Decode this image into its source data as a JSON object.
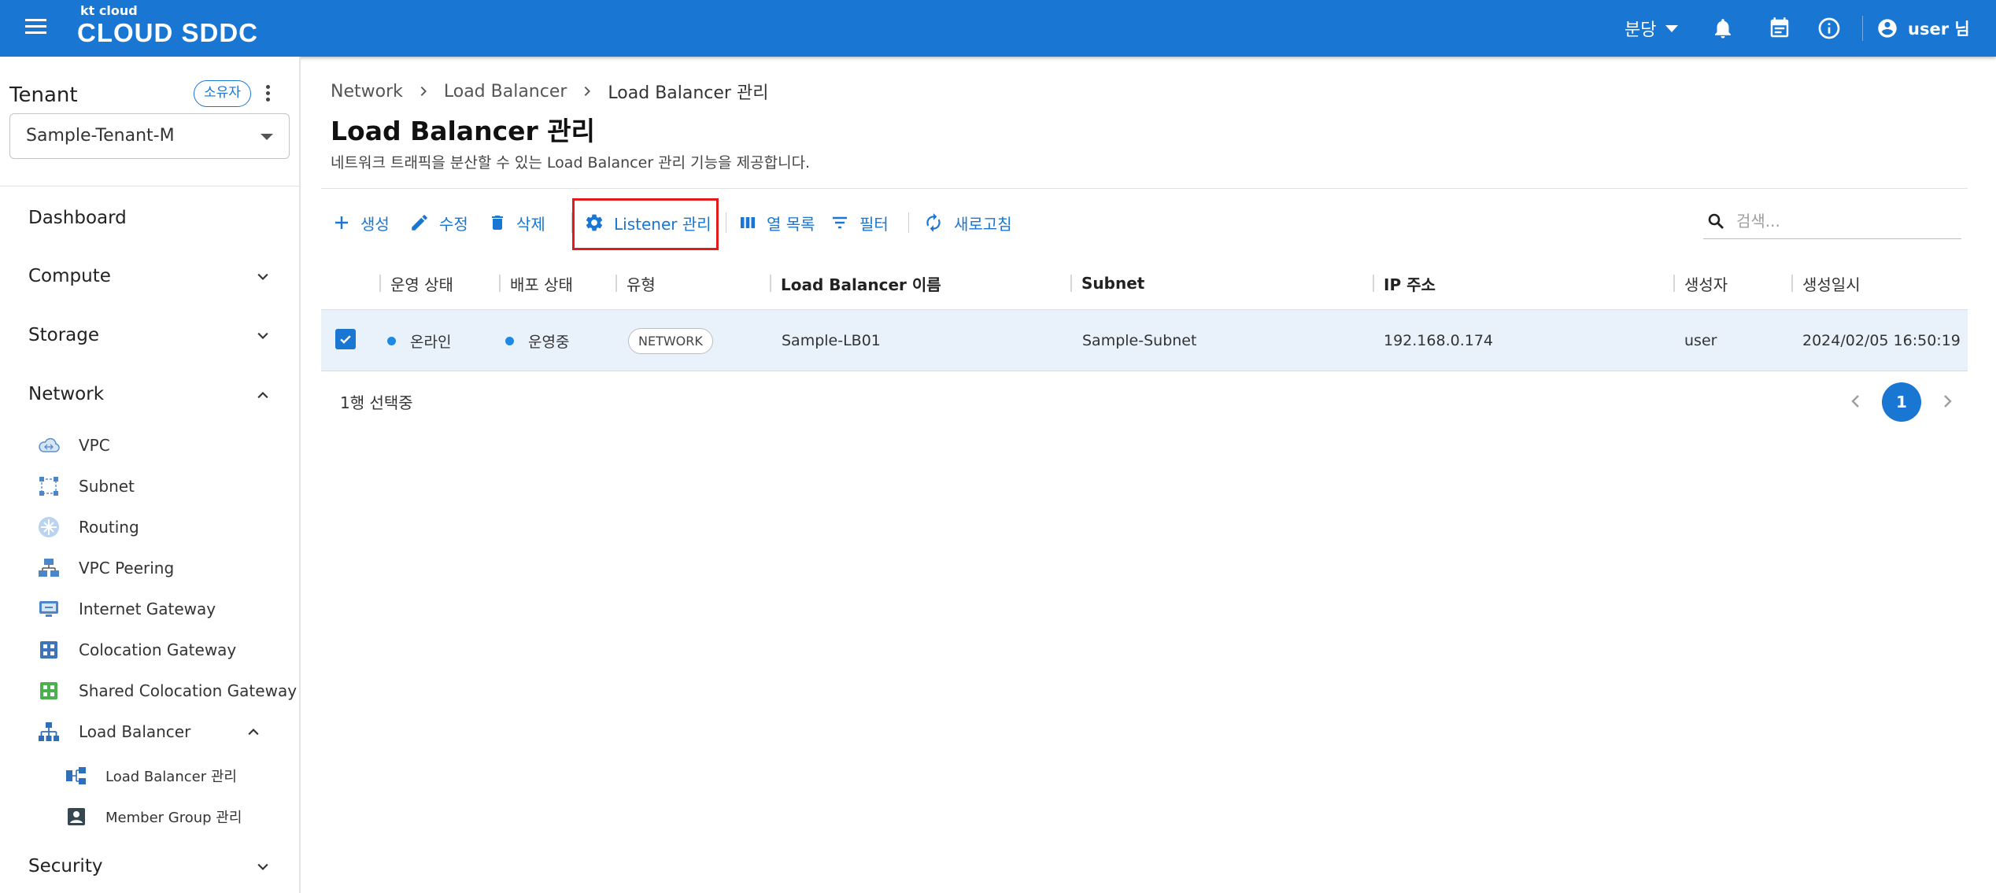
{
  "app": {
    "logo_small": "kt cloud",
    "logo_main": "CLOUD SDDC",
    "branch": "분당",
    "user": "user 님"
  },
  "sidebar": {
    "tenant_title": "Tenant",
    "owner_badge": "소유자",
    "tenant_selected": "Sample-Tenant-M",
    "menu": {
      "dashboard": "Dashboard",
      "compute": "Compute",
      "storage": "Storage",
      "network": "Network",
      "security": "Security"
    },
    "network_items": {
      "vpc": "VPC",
      "subnet": "Subnet",
      "routing": "Routing",
      "vpc_peering": "VPC Peering",
      "internet_gateway": "Internet Gateway",
      "colocation_gateway": "Colocation Gateway",
      "shared_colocation_gateway": "Shared Colocation Gateway",
      "load_balancer": "Load Balancer"
    },
    "lb_items": {
      "lb_manage": "Load Balancer 관리",
      "member_group": "Member Group 관리"
    }
  },
  "breadcrumb": [
    "Network",
    "Load Balancer",
    "Load Balancer 관리"
  ],
  "page": {
    "title": "Load Balancer 관리",
    "description": "네트워크 트래픽을 분산할 수 있는 Load Balancer 관리 기능을 제공합니다."
  },
  "toolbar": {
    "create": "생성",
    "edit": "수정",
    "delete": "삭제",
    "listener": "Listener 관리",
    "columns": "열 목록",
    "filter": "필터",
    "refresh": "새로고침",
    "search_placeholder": "검색..."
  },
  "table": {
    "headers": {
      "op_status": "운영 상태",
      "deploy_status": "배포 상태",
      "type": "유형",
      "lb_name": "Load Balancer 이름",
      "subnet": "Subnet",
      "ip": "IP 주소",
      "creator": "생성자",
      "created_at": "생성일시"
    },
    "rows": [
      {
        "selected": true,
        "op_status": "온라인",
        "deploy_status": "운영중",
        "type": "NETWORK",
        "lb_name": "Sample-LB01",
        "subnet": "Sample-Subnet",
        "ip": "192.168.0.174",
        "creator": "user",
        "created_at": "2024/02/05 16:50:19"
      }
    ]
  },
  "footer": {
    "selection": "1행 선택중",
    "current_page": "1"
  },
  "colors": {
    "primary": "#1976d2",
    "highlight": "#e11a1a",
    "row_selected": "#e9f1fb",
    "status_dot": "#1e88e5"
  }
}
